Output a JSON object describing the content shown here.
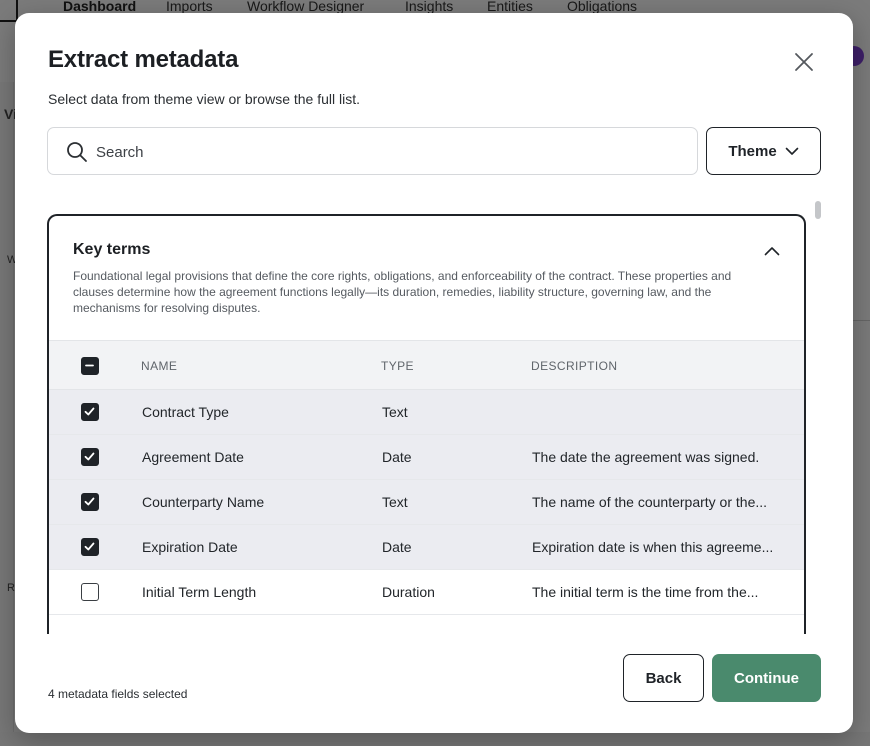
{
  "background": {
    "nav_items": [
      "Dashboard",
      "Imports",
      "Workflow Designer",
      "Insights",
      "Entities",
      "Obligations"
    ],
    "side_fragments": [
      "Vi",
      "W",
      "R"
    ]
  },
  "modal": {
    "title": "Extract metadata",
    "subtitle": "Select data from theme view or browse the full list.",
    "search": {
      "placeholder": "Search",
      "value": ""
    },
    "theme_button": "Theme",
    "section": {
      "title": "Key terms",
      "description": "Foundational legal provisions that define the core rights, obligations, and enforceability of the contract. These properties and clauses determine how the agreement functions legally—its duration, remedies, liability structure, governing law, and the mechanisms for resolving disputes.",
      "columns": {
        "name": "NAME",
        "type": "TYPE",
        "description": "DESCRIPTION"
      },
      "rows": [
        {
          "name": "Contract Type",
          "type": "Text",
          "description": "",
          "checked": true
        },
        {
          "name": "Agreement Date",
          "type": "Date",
          "description": "The date the agreement was signed.",
          "checked": true
        },
        {
          "name": "Counterparty Name",
          "type": "Text",
          "description": "The name of the counterparty or the...",
          "checked": true
        },
        {
          "name": "Expiration Date",
          "type": "Date",
          "description": "Expiration date is when this agreeme...",
          "checked": true
        },
        {
          "name": "Initial Term Length",
          "type": "Duration",
          "description": "The initial term is the time from the...",
          "checked": false
        }
      ]
    },
    "footer": {
      "selected_count": "4 metadata fields selected",
      "back_label": "Back",
      "continue_label": "Continue"
    }
  },
  "colors": {
    "primary_dark": "#1f2328",
    "continue_green": "#4a8a6d",
    "selected_row": "#ebecf1",
    "avatar": "#7a3fd1"
  }
}
